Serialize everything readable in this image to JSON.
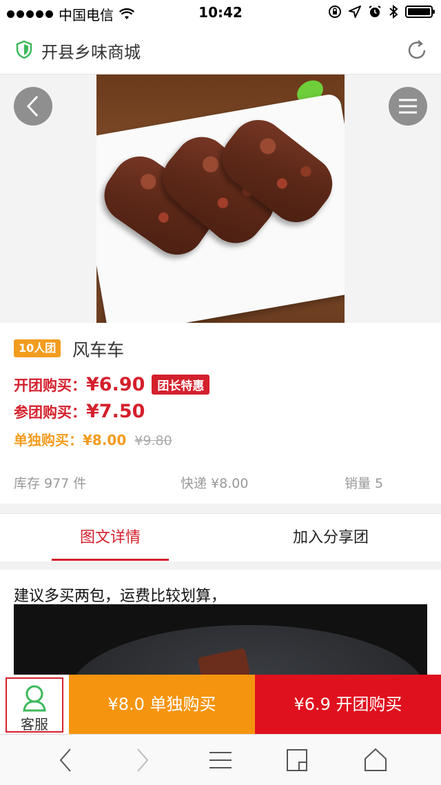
{
  "status_bar": {
    "carrier": "中国电信",
    "time": "10:42",
    "battery_level": 1.0
  },
  "header": {
    "title": "开县乡味商城",
    "shield_icon": "shield-icon",
    "refresh_icon": "refresh-icon"
  },
  "product": {
    "group_badge": "10人团",
    "name": "风车车",
    "open_group_label": "开团购买：",
    "open_group_price": "¥6.90",
    "leader_tag": "团长特惠",
    "join_group_label": "参团购买：",
    "join_group_price": "¥7.50",
    "single_label": "单独购买：",
    "single_price": "¥8.00",
    "original_price": "¥9.80",
    "stock": "库存 977 件",
    "shipping": "快递 ¥8.00",
    "sales": "销量 5"
  },
  "tabs": [
    {
      "label": "图文详情",
      "active": true
    },
    {
      "label": "加入分享团",
      "active": false
    }
  ],
  "detail": {
    "text": "建议多买两包，运费比较划算，"
  },
  "actions": {
    "service_label": "客服",
    "single_buy": "¥8.0 单独购买",
    "group_buy": "¥6.9 开团购买"
  },
  "colors": {
    "accent_red": "#d4202c",
    "orange": "#f29c1f",
    "group_button": "#e0111e",
    "single_button": "#f5950f",
    "shield_green": "#3cb95a"
  }
}
